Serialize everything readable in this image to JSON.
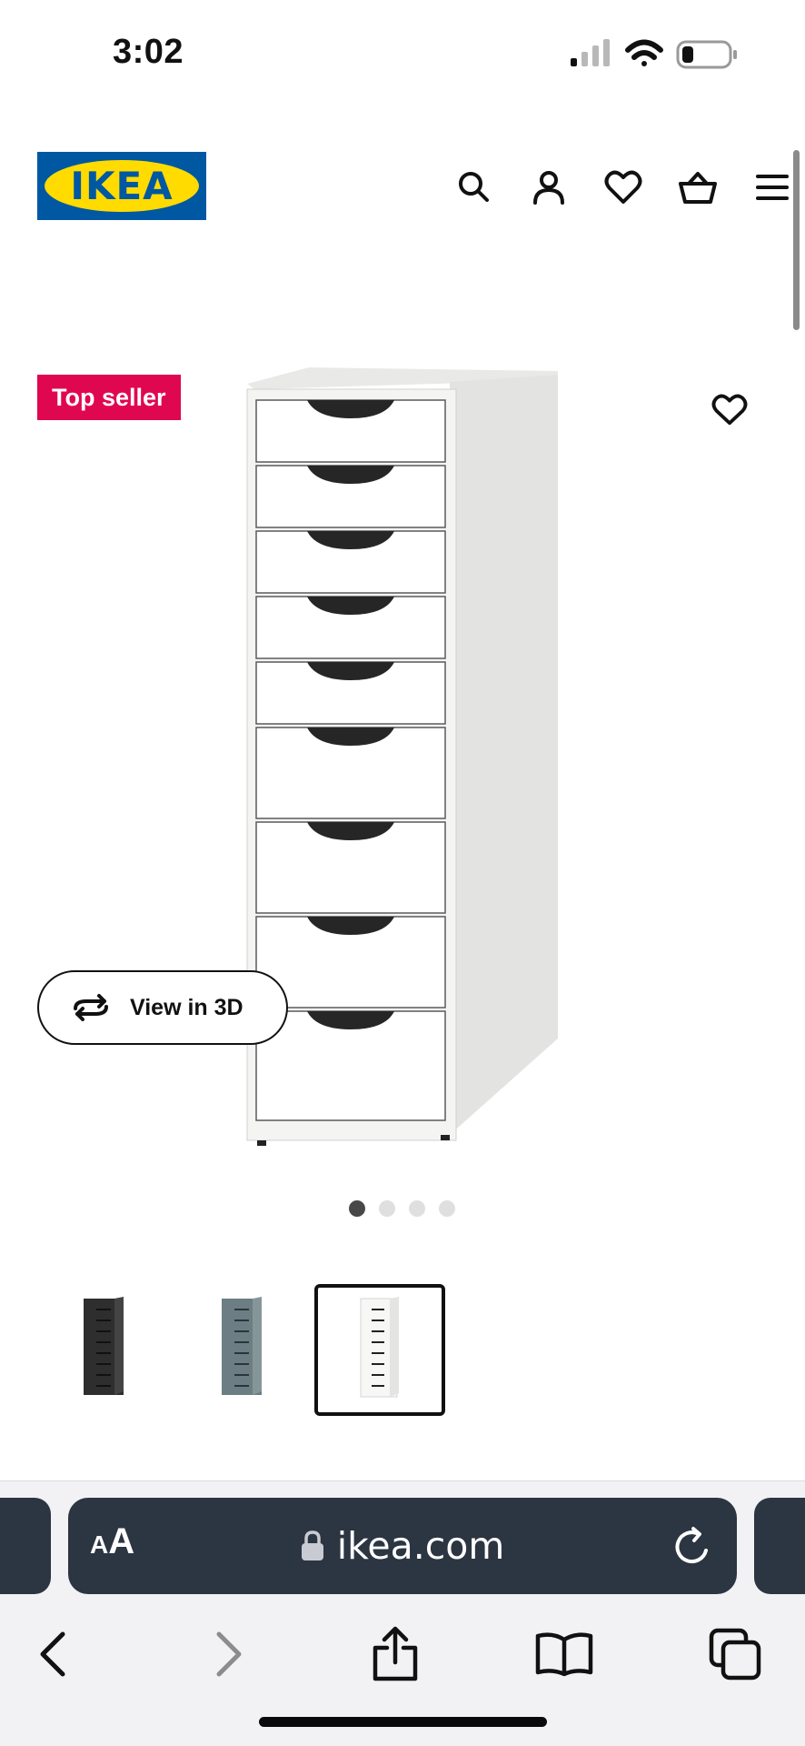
{
  "status_bar": {
    "time": "3:02",
    "icons": [
      "cellular-signal-icon",
      "wifi-icon",
      "battery-icon"
    ]
  },
  "header": {
    "logo_text": "IKEA",
    "icons": [
      "search-icon",
      "account-icon",
      "wishlist-heart-icon",
      "shopping-basket-icon",
      "menu-icon"
    ]
  },
  "product": {
    "badge": "Top seller",
    "view_3d_label": "View in 3D",
    "image_count": 4,
    "active_image_index": 1,
    "variants": [
      {
        "name": "black-brown",
        "color": "#3a3a3a",
        "selected": false
      },
      {
        "name": "grey-turquoise",
        "color": "#6f8185",
        "selected": false
      },
      {
        "name": "white",
        "color": "#f4f4f2",
        "selected": true
      }
    ]
  },
  "safari": {
    "text_size_label_small": "A",
    "text_size_label_big": "A",
    "url": "ikea.com",
    "address_bar_color": "#2c3542"
  },
  "colors": {
    "ikea_blue": "#0058a3",
    "ikea_yellow": "#ffdb00",
    "badge_red": "#e00751"
  }
}
